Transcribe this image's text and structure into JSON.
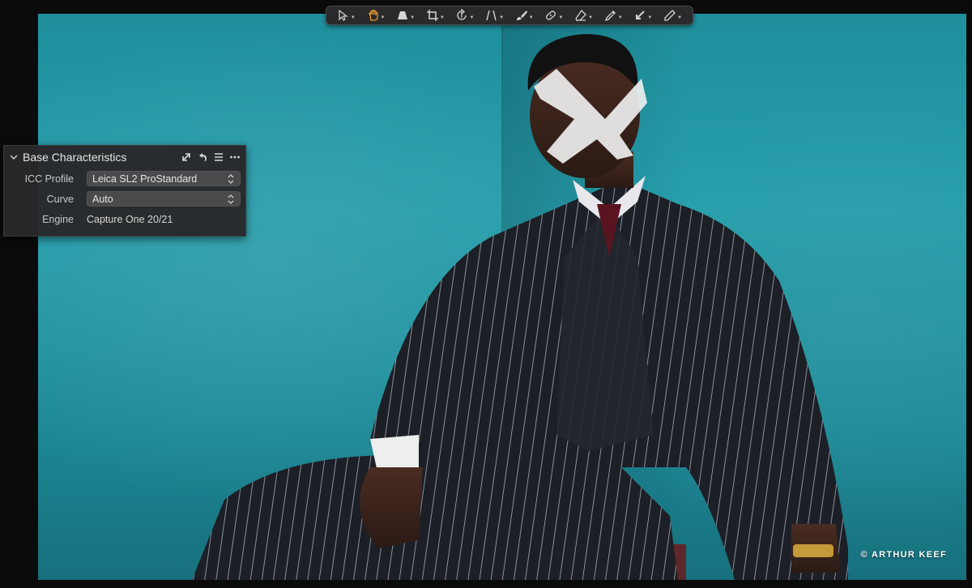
{
  "toolbar": {
    "tools": [
      {
        "name": "select-tool",
        "icon": "arrow-cursor-icon"
      },
      {
        "name": "pan-tool",
        "icon": "hand-icon",
        "active": true
      },
      {
        "name": "keystone-tool",
        "icon": "keystone-icon"
      },
      {
        "name": "crop-tool",
        "icon": "crop-icon"
      },
      {
        "name": "rotate-tool",
        "icon": "rotate-icon"
      },
      {
        "name": "straighten-tool",
        "icon": "straighten-icon"
      },
      {
        "name": "brush-tool",
        "icon": "brush-icon"
      },
      {
        "name": "heal-tool",
        "icon": "bandage-icon"
      },
      {
        "name": "eraser-tool",
        "icon": "eraser-icon"
      },
      {
        "name": "color-picker-tool",
        "icon": "eyedropper-icon"
      },
      {
        "name": "annotate-tool",
        "icon": "arrow-pick-icon"
      },
      {
        "name": "draw-tool",
        "icon": "pencil-icon"
      }
    ],
    "active_color": "#f0a030"
  },
  "panel": {
    "title": "Base Characteristics",
    "rows": {
      "icc_profile": {
        "label": "ICC Profile",
        "value": "Leica SL2 ProStandard"
      },
      "curve": {
        "label": "Curve",
        "value": "Auto"
      },
      "engine": {
        "label": "Engine",
        "value": "Capture One 20/21"
      }
    }
  },
  "photo": {
    "credit": "© ARTHUR KEEF",
    "background_color": "#1f95a2"
  }
}
